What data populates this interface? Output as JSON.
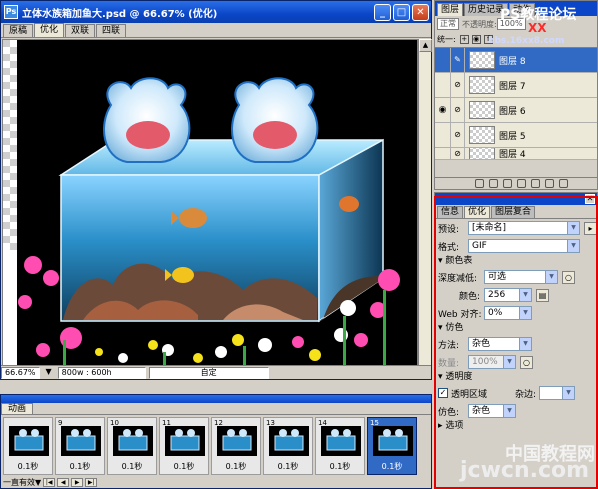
{
  "document": {
    "title": "立体水族箱加鱼大.psd @ 66.67% (优化)",
    "tabs": [
      "原稿",
      "优化",
      "双联",
      "四联"
    ],
    "zoom": "66.67%",
    "size_info": "800w : 600h",
    "custom": "自定"
  },
  "animation": {
    "tab": "动画",
    "frames": [
      {
        "num": "",
        "time": "0.1秒"
      },
      {
        "num": "9",
        "time": "0.1秒"
      },
      {
        "num": "10",
        "time": "0.1秒"
      },
      {
        "num": "11",
        "time": "0.1秒"
      },
      {
        "num": "12",
        "time": "0.1秒"
      },
      {
        "num": "13",
        "time": "0.1秒"
      },
      {
        "num": "14",
        "time": "0.1秒"
      },
      {
        "num": "15",
        "time": "0.1秒"
      }
    ],
    "loop": "一直有效"
  },
  "layers_panel": {
    "tabs": [
      "图层",
      "历史记录",
      "动作"
    ],
    "blend_mode": "正常",
    "opacity_label": "不透明度:",
    "opacity": "100%",
    "unify_label": "统一:",
    "layers": [
      {
        "name": "图层 8",
        "visible": false,
        "selected": true
      },
      {
        "name": "图层 7",
        "visible": false,
        "selected": false
      },
      {
        "name": "图层 6",
        "visible": true,
        "selected": false
      },
      {
        "name": "图层 5",
        "visible": false,
        "selected": false
      },
      {
        "name": "图层 4",
        "visible": false,
        "selected": false
      }
    ]
  },
  "optimize_panel": {
    "tabs": [
      "信息",
      "优化",
      "图层复合"
    ],
    "preset_label": "预设:",
    "preset": "[未命名]",
    "format_label": "格式:",
    "format": "GIF",
    "color_table_section": "颜色表",
    "depth_label": "深度减低:",
    "depth": "可选",
    "colors_label": "颜色:",
    "colors": "256",
    "web_label": "Web 对齐:",
    "web": "0%",
    "dither_section": "仿色",
    "method_label": "方法:",
    "method": "杂色",
    "amount_label": "数量:",
    "amount": "100%",
    "transparency_section": "透明度",
    "transparency_check": "透明区域",
    "matte_label": "杂边:",
    "dither2_label": "仿色:",
    "dither2": "杂色",
    "options_label": "选项"
  },
  "watermarks": {
    "top": "PS教程论坛",
    "top_xx": "XX",
    "top_url": "bbs.16xx8.com",
    "bottom_cn": "中国教程网",
    "bottom_url": "jcwcn.com"
  },
  "colors": {
    "accent_red": "#e30000",
    "xp_blue": "#0b46c8",
    "selection": "#316ac5"
  }
}
